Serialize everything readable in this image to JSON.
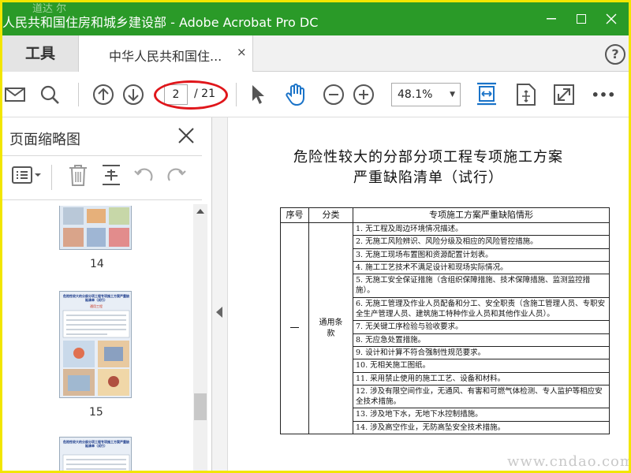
{
  "window": {
    "title": "人民共和国住房和城乡建设部 - Adobe Acrobat Pro DC",
    "watermark_top": "道达 尔"
  },
  "tabs": {
    "tools": "工具",
    "document": "中华人民共和国住...",
    "close": "×",
    "help": "?"
  },
  "toolbar": {
    "page_current": "2",
    "page_total": "/ 21",
    "zoom": "48.1%",
    "more": "•••"
  },
  "sidebar": {
    "title": "页面缩略图",
    "pages": [
      "14",
      "15"
    ],
    "thumb_title": "危险性较大的分部分项工程专项施工方案严重缺陷清单（试行）",
    "thumb_sub": "通用工程"
  },
  "document": {
    "title_line1": "危险性较大的分部分项工程专项施工方案",
    "title_line2": "严重缺陷清单（试行）",
    "table": {
      "headers": [
        "序号",
        "分类",
        "专项施工方案严重缺陷情形"
      ],
      "group_no": "一",
      "group_category": "通用条款",
      "rows": [
        "1. 无工程及周边环境情况描述。",
        "2. 无施工风险辨识、风险分级及相应的风险管控措施。",
        "3. 无施工现场布置图和资源配置计划表。",
        "4. 施工工艺技术不满足设计和现场实际情况。",
        "5. 无施工安全保证措施（含组织保障措施、技术保障措施、监测监控措施）。",
        "6. 无施工管理及作业人员配备和分工、安全职责（含施工管理人员、专职安全生产管理人员、建筑施工特种作业人员和其他作业人员）。",
        "7. 无关键工序检验与验收要求。",
        "8. 无应急处置措施。",
        "9. 设计和计算不符合强制性规范要求。",
        "10. 无相关施工图纸。",
        "11. 采用禁止使用的施工工艺、设备和材料。",
        "12. 涉及有限空间作业，无通风、有害和可燃气体检测、专人监护等相应安全技术措施。",
        "13. 涉及地下水，无地下水控制措施。",
        "14. 涉及高空作业，无防高坠安全技术措施。"
      ]
    },
    "watermark": "www.cndao.com"
  }
}
